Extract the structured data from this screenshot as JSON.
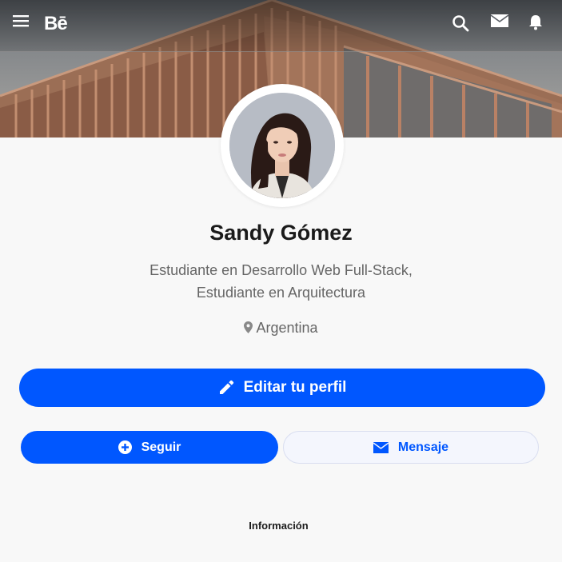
{
  "nav": {
    "logo": "Bē",
    "icons": [
      "menu-icon",
      "search-icon",
      "mail-icon",
      "bell-icon"
    ]
  },
  "profile": {
    "name": "Sandy Gómez",
    "bio_line1": "Estudiante en Desarrollo Web Full-Stack,",
    "bio_line2": "Estudiante en Arquitectura",
    "location": "Argentina"
  },
  "actions": {
    "edit_label": "Editar tu perfil",
    "follow_label": "Seguir",
    "message_label": "Mensaje"
  },
  "sections": {
    "info_label": "Información"
  },
  "colors": {
    "accent": "#0057ff",
    "background": "#f8f8f8",
    "text_primary": "#1a1a1a",
    "text_secondary": "#666666"
  }
}
